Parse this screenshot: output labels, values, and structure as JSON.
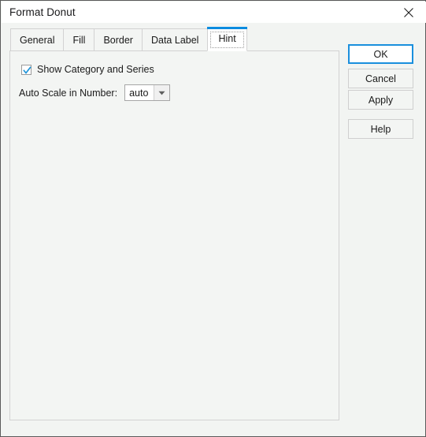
{
  "window": {
    "title": "Format Donut",
    "close_icon": "close-icon"
  },
  "tabs": [
    {
      "label": "General",
      "selected": false
    },
    {
      "label": "Fill",
      "selected": false
    },
    {
      "label": "Border",
      "selected": false
    },
    {
      "label": "Data Label",
      "selected": false
    },
    {
      "label": "Hint",
      "selected": true
    }
  ],
  "panel": {
    "checkbox": {
      "label": "Show Category and Series",
      "checked": true
    },
    "select": {
      "label": "Auto Scale in Number:",
      "value": "auto",
      "options": [
        "auto"
      ]
    }
  },
  "buttons": {
    "ok": "OK",
    "cancel": "Cancel",
    "apply": "Apply",
    "help": "Help"
  },
  "colors": {
    "accent": "#0c8ce0",
    "default_button_border": "#1a8fdd",
    "check_mark": "#2196d9",
    "window_border": "#5a5a5a",
    "panel_bg": "#f3f5f3",
    "titlebar_bg": "#ffffff"
  }
}
